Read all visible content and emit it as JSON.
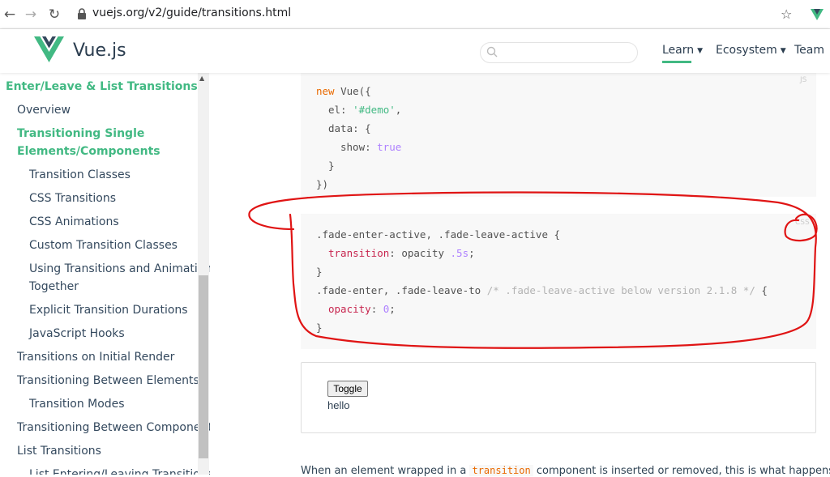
{
  "browser": {
    "url": "vuejs.org/v2/guide/transitions.html"
  },
  "header": {
    "logo_text": "Vue.js",
    "nav": {
      "learn": "Learn",
      "ecosystem": "Ecosystem",
      "team": "Team"
    },
    "accent_color": "#42b983"
  },
  "sidebar": {
    "items": [
      {
        "label": "Enter/Leave & List Transitions",
        "level": 0,
        "active": true
      },
      {
        "label": "Overview",
        "level": 1
      },
      {
        "label": "Transitioning Single",
        "level": 1,
        "active": true
      },
      {
        "label": "Elements/Components",
        "level": 1,
        "active": true
      },
      {
        "label": "Transition Classes",
        "level": 2
      },
      {
        "label": "CSS Transitions",
        "level": 2
      },
      {
        "label": "CSS Animations",
        "level": 2
      },
      {
        "label": "Custom Transition Classes",
        "level": 2
      },
      {
        "label": "Using Transitions and Animations",
        "level": 2
      },
      {
        "label": "Together",
        "level": 2
      },
      {
        "label": "Explicit Transition Durations",
        "level": 2
      },
      {
        "label": "JavaScript Hooks",
        "level": 2
      },
      {
        "label": "Transitions on Initial Render",
        "level": 1
      },
      {
        "label": "Transitioning Between Elements",
        "level": 1
      },
      {
        "label": "Transition Modes",
        "level": 2
      },
      {
        "label": "Transitioning Between Components",
        "level": 1
      },
      {
        "label": "List Transitions",
        "level": 1
      },
      {
        "label": "List Entering/Leaving Transitions",
        "level": 2
      }
    ]
  },
  "code_js": {
    "lang": "JS",
    "lines": [
      "new Vue({",
      "el: '#demo',",
      "data: {",
      "show: true",
      "}",
      "})"
    ]
  },
  "code_css": {
    "lang": "CSS",
    "lines": [
      ".fade-enter-active, .fade-leave-active {",
      "transition: opacity .5s;",
      "}",
      ".fade-enter, .fade-leave-to /* .fade-leave-active below version 2.1.8 */ {",
      "opacity: 0;",
      "}"
    ]
  },
  "demo": {
    "button_label": "Toggle",
    "text": "hello"
  },
  "body_text": {
    "before": "When an element wrapped in a",
    "code": "transition",
    "after": "component is inserted or removed, this is what happens:"
  }
}
